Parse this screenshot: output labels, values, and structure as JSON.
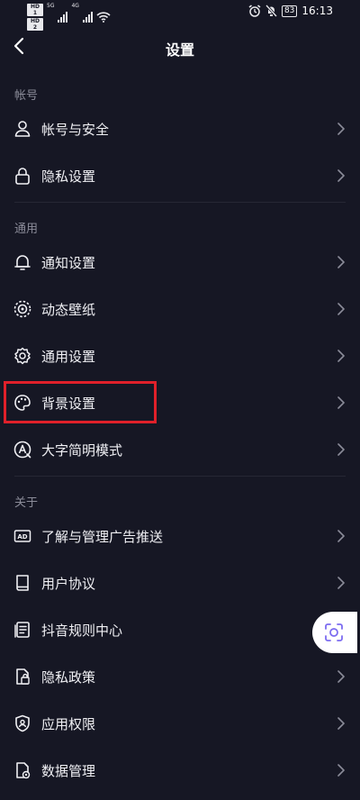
{
  "status_bar": {
    "hd1": "HD 1",
    "hd2": "HD 2",
    "net1": "5G",
    "net2": "4G",
    "battery": "83",
    "time": "16:13"
  },
  "header": {
    "title": "设置"
  },
  "sections": {
    "account": {
      "label": "帐号",
      "items": [
        {
          "label": "帐号与安全"
        },
        {
          "label": "隐私设置"
        }
      ]
    },
    "general": {
      "label": "通用",
      "items": [
        {
          "label": "通知设置"
        },
        {
          "label": "动态壁纸"
        },
        {
          "label": "通用设置"
        },
        {
          "label": "背景设置"
        },
        {
          "label": "大字简明模式"
        }
      ]
    },
    "about": {
      "label": "关于",
      "items": [
        {
          "label": "了解与管理广告推送"
        },
        {
          "label": "用户协议"
        },
        {
          "label": "抖音规则中心"
        },
        {
          "label": "隐私政策"
        },
        {
          "label": "应用权限"
        },
        {
          "label": "数据管理"
        }
      ]
    }
  },
  "icons": {
    "ad_icon_text": "AD"
  },
  "colors": {
    "background": "#161724",
    "text": "#f0f0f4",
    "section_label": "#8b8c99",
    "highlight": "#e0202a"
  }
}
